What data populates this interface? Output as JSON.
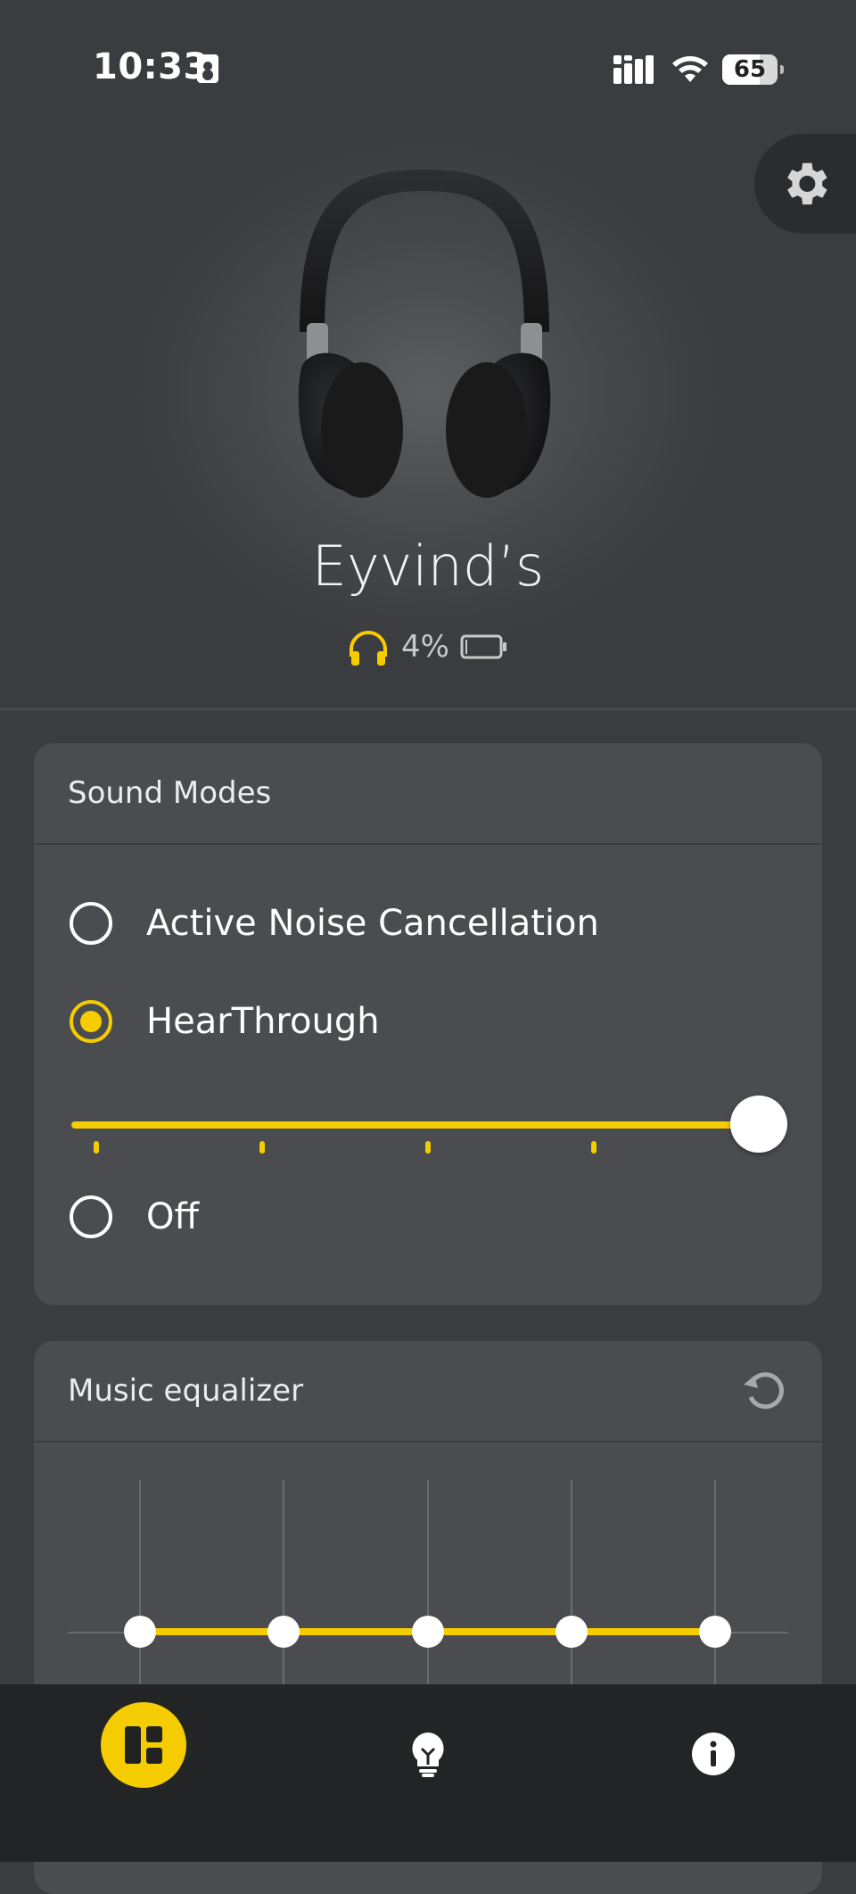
{
  "status_bar": {
    "time": "10:33",
    "battery": "65"
  },
  "device": {
    "name": "Eyvind’s",
    "battery_percent": "4%"
  },
  "sound_modes": {
    "title": "Sound Modes",
    "options": [
      {
        "label": "Active Noise Cancellation",
        "selected": false
      },
      {
        "label": "HearThrough",
        "selected": true
      },
      {
        "label": "Off",
        "selected": false
      }
    ],
    "hearthrough_level": 1.0
  },
  "equalizer": {
    "title": "Music equalizer",
    "band_levels": [
      0,
      0,
      0,
      0,
      0
    ]
  },
  "colors": {
    "accent": "#f5cc00",
    "background": "#3b3c3f",
    "card": "#4b4c50",
    "nav": "#222426"
  },
  "icons": {
    "settings": "gear-icon",
    "reset": "reset-icon",
    "home": "dashboard-icon",
    "tips": "lightbulb-icon",
    "info": "info-icon"
  }
}
